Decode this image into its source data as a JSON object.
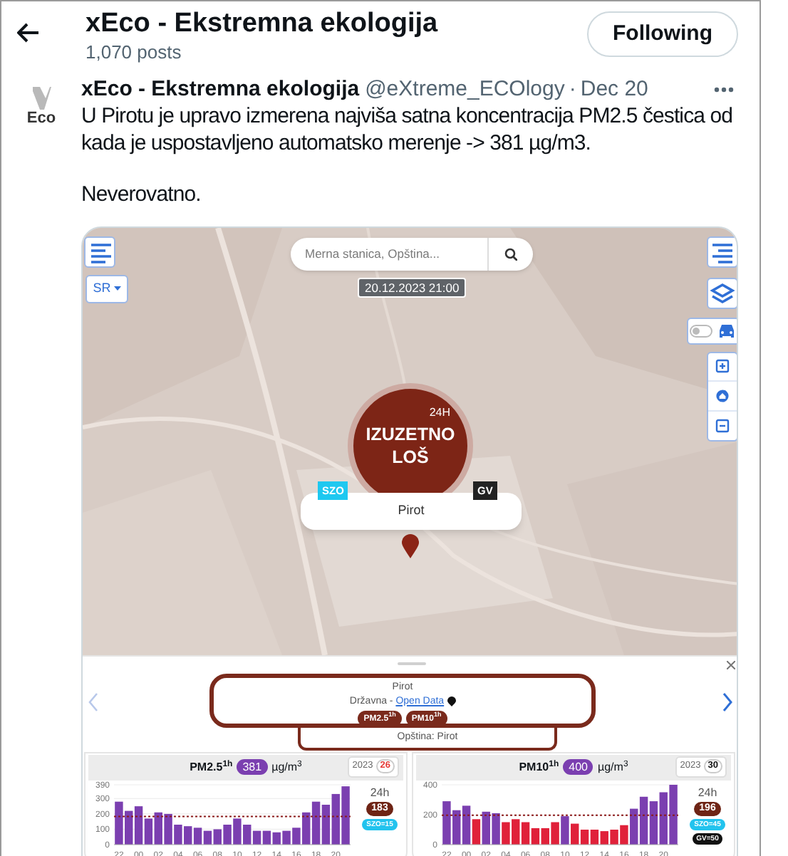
{
  "header": {
    "title": "xEco - Ekstremna ekologija",
    "post_count": "1,070 posts",
    "follow_button": "Following"
  },
  "tweet": {
    "avatar_text": "Eco",
    "author": "xEco - Ekstremna ekologija",
    "handle": "@eXtreme_ECOlogy",
    "separator": "·",
    "date": "Dec 20",
    "paragraphs": [
      "U Pirotu je upravo izmerena najviša satna koncentracija PM2.5 čestica od kada je uspostavljeno automatsko merenje -> 381 µg/m3.",
      "Neverovatno."
    ]
  },
  "map": {
    "search": {
      "placeholder": "Merna stanica, Opština..."
    },
    "language": "SR",
    "timestamp": "20.12.2023 21:00",
    "traffic_toggle": {
      "on": false
    },
    "marker": {
      "period": "24H",
      "status": "IZUZETNO LOŠ",
      "badges": [
        {
          "label": "SZO",
          "color": "#1ec8f0"
        },
        {
          "label": "GV",
          "color": "#222222"
        }
      ],
      "popup": "Pirot"
    }
  },
  "station_panel": {
    "name": "Pirot",
    "type": "Državna - ",
    "source_link": "Open Data",
    "pollutants": [
      "PM2.5$^{1h}$",
      "PM10$^{1h}$"
    ],
    "municipality": "Opština: Pirot"
  },
  "charts": [
    {
      "pollutant": "PM2.5$^{1h}$",
      "value": "381",
      "unit": "µg/m$^{3}$",
      "year": "2023",
      "exceedance": {
        "count": "26",
        "color": "#e53935"
      },
      "avg_label": "24h",
      "avg_value": "183",
      "limits": [
        {
          "label": "SZO=15",
          "color": "#22c3ee"
        }
      ],
      "chart_data": {
        "type": "bar",
        "categories": [
          "22",
          null,
          "00",
          null,
          "02",
          null,
          "04",
          null,
          "06",
          null,
          "08",
          null,
          "10",
          null,
          "12",
          null,
          "14",
          null,
          "16",
          null,
          "18",
          null,
          "20",
          null
        ],
        "series": [
          {
            "color": "#7b3fb0",
            "values": [
              280,
              220,
              250,
              170,
              210,
              200,
              130,
              120,
              110,
              90,
              100,
              130,
              170,
              130,
              90,
              90,
              80,
              90,
              110,
              210,
              280,
              260,
              330,
              380
            ]
          }
        ],
        "ylim": [
          0,
          390
        ],
        "yticks": [
          0,
          100,
          200,
          300,
          390
        ],
        "grid": true,
        "ref_lines": [
          {
            "axis": "y",
            "value": 183
          }
        ]
      }
    },
    {
      "pollutant": "PM10$^{1h}$",
      "value": "400",
      "unit": "µg/m$^{3}$",
      "year": "2023",
      "exceedance": {
        "count": "30",
        "color": "#111111"
      },
      "avg_label": "24h",
      "avg_value": "196",
      "limits": [
        {
          "label": "SZO=45",
          "color": "#22c3ee"
        },
        {
          "label": "GV=50",
          "color": "#111111"
        }
      ],
      "chart_data": {
        "type": "bar",
        "stacked": true,
        "categories": [
          "22",
          null,
          "00",
          null,
          "02",
          null,
          "04",
          null,
          "06",
          null,
          "08",
          null,
          "10",
          null,
          "12",
          null,
          "14",
          null,
          "16",
          null,
          "18",
          null,
          "20",
          null
        ],
        "series": [
          {
            "color": "#7b3fb0",
            "values": [
              290,
              230,
              260,
              null,
              220,
              210,
              null,
              null,
              null,
              null,
              null,
              null,
              190,
              null,
              null,
              null,
              null,
              null,
              null,
              240,
              320,
              290,
              350,
              400
            ]
          },
          {
            "color": "#e0213a",
            "values": [
              null,
              null,
              null,
              170,
              null,
              null,
              150,
              170,
              150,
              110,
              110,
              150,
              null,
              140,
              100,
              100,
              90,
              100,
              130,
              null,
              null,
              null,
              null,
              null
            ]
          }
        ],
        "ylim": [
          0,
          400
        ],
        "yticks": [
          0,
          200,
          400
        ],
        "grid": true,
        "ref_lines": [
          {
            "axis": "y",
            "value": 196
          }
        ]
      }
    }
  ]
}
